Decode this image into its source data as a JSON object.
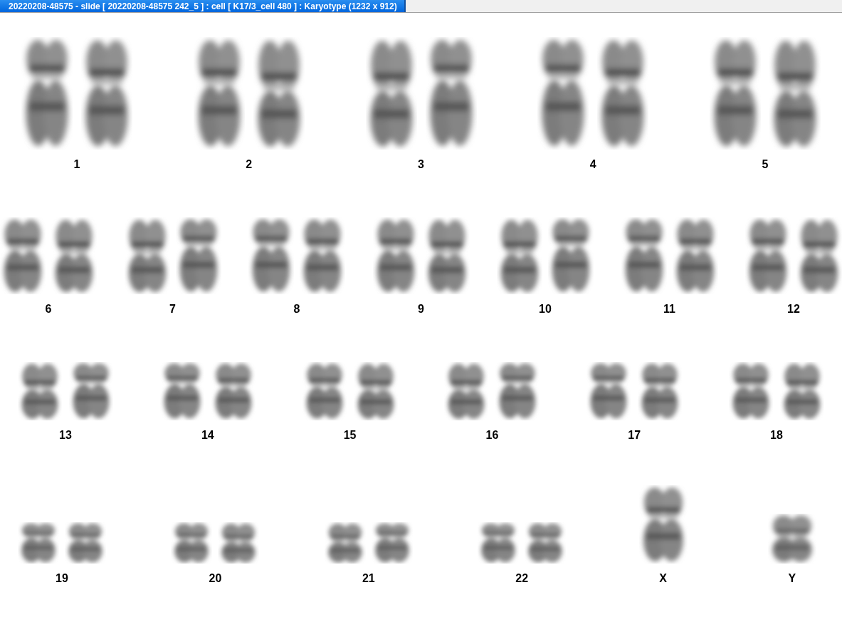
{
  "window": {
    "title": "20220208-48575 - slide [ 20220208-48575 242_5 ] : cell [ K17/3_cell 480 ] : Karyotype  (1232 x 912)"
  },
  "karyotype": {
    "rows": [
      {
        "groups": [
          {
            "label": "1",
            "kind": "pair"
          },
          {
            "label": "2",
            "kind": "pair"
          },
          {
            "label": "3",
            "kind": "pair"
          },
          {
            "label": "4",
            "kind": "pair"
          },
          {
            "label": "5",
            "kind": "pair"
          }
        ]
      },
      {
        "groups": [
          {
            "label": "6",
            "kind": "pair"
          },
          {
            "label": "7",
            "kind": "pair"
          },
          {
            "label": "8",
            "kind": "pair"
          },
          {
            "label": "9",
            "kind": "pair"
          },
          {
            "label": "10",
            "kind": "pair"
          },
          {
            "label": "11",
            "kind": "pair"
          },
          {
            "label": "12",
            "kind": "pair"
          }
        ]
      },
      {
        "groups": [
          {
            "label": "13",
            "kind": "pair"
          },
          {
            "label": "14",
            "kind": "pair"
          },
          {
            "label": "15",
            "kind": "pair"
          },
          {
            "label": "16",
            "kind": "pair"
          },
          {
            "label": "17",
            "kind": "pair"
          },
          {
            "label": "18",
            "kind": "pair"
          }
        ]
      },
      {
        "groups": [
          {
            "label": "19",
            "kind": "pair"
          },
          {
            "label": "20",
            "kind": "pair"
          },
          {
            "label": "21",
            "kind": "pair"
          },
          {
            "label": "22",
            "kind": "pair"
          },
          {
            "label": "X",
            "kind": "single"
          },
          {
            "label": "Y",
            "kind": "single"
          }
        ]
      }
    ]
  }
}
